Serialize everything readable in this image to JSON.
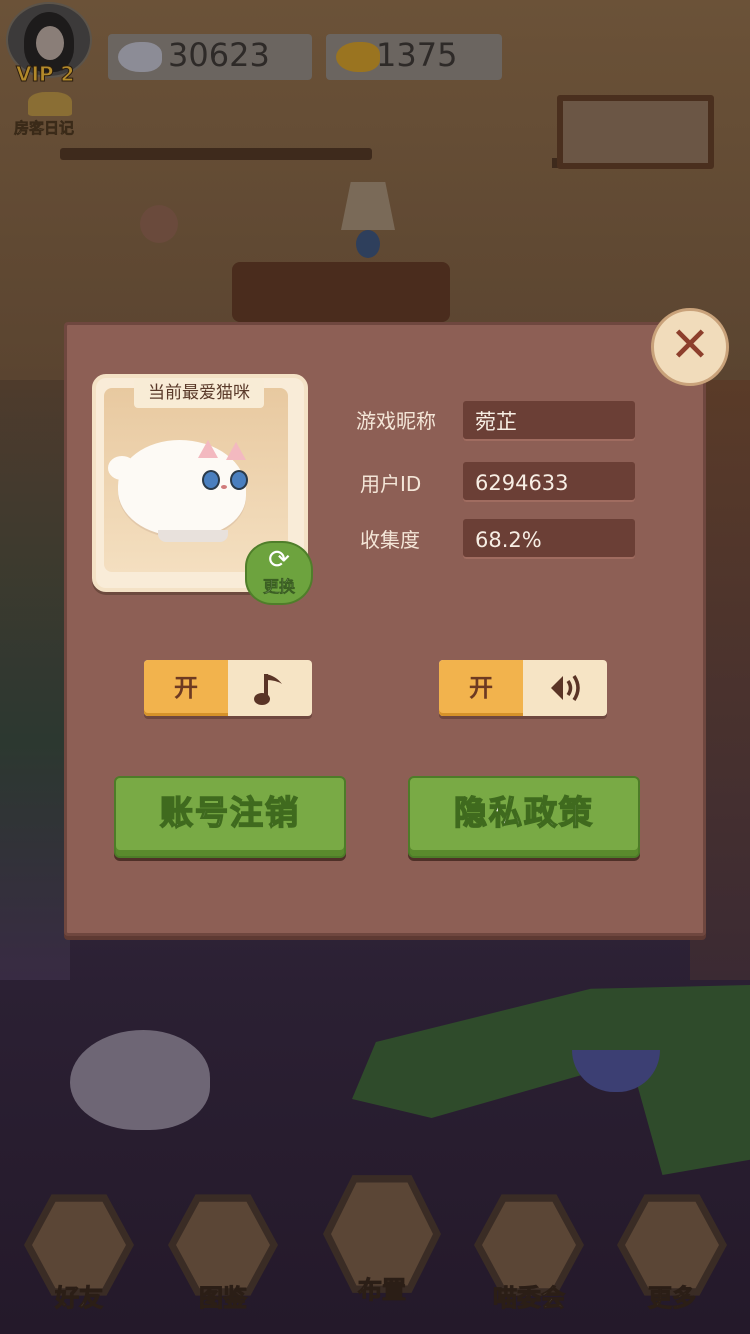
{
  "top_bar": {
    "vip_label": "VIP 2",
    "diary_label": "房客日记",
    "silver_fish": "30623",
    "gold_fish": "1375"
  },
  "dialog": {
    "favorite_cat_title": "当前最爱猫咪",
    "change_label": "更换",
    "nickname_label": "游戏昵称",
    "nickname_value": "菀芷",
    "user_id_label": "用户ID",
    "user_id_value": "6294633",
    "collection_label": "收集度",
    "collection_value": "68.2%",
    "music_toggle_label": "开",
    "sound_toggle_label": "开",
    "logout_button": "账号注销",
    "privacy_button": "隐私政策"
  },
  "bottom_nav": {
    "items": [
      {
        "label": "好友"
      },
      {
        "label": "图鉴"
      },
      {
        "label": "布置"
      },
      {
        "label": "喵委会"
      },
      {
        "label": "更多"
      }
    ]
  },
  "colors": {
    "dialog_bg": "#8d5f55",
    "toggle_on": "#f2b34d",
    "button_green": "#79aa45"
  }
}
